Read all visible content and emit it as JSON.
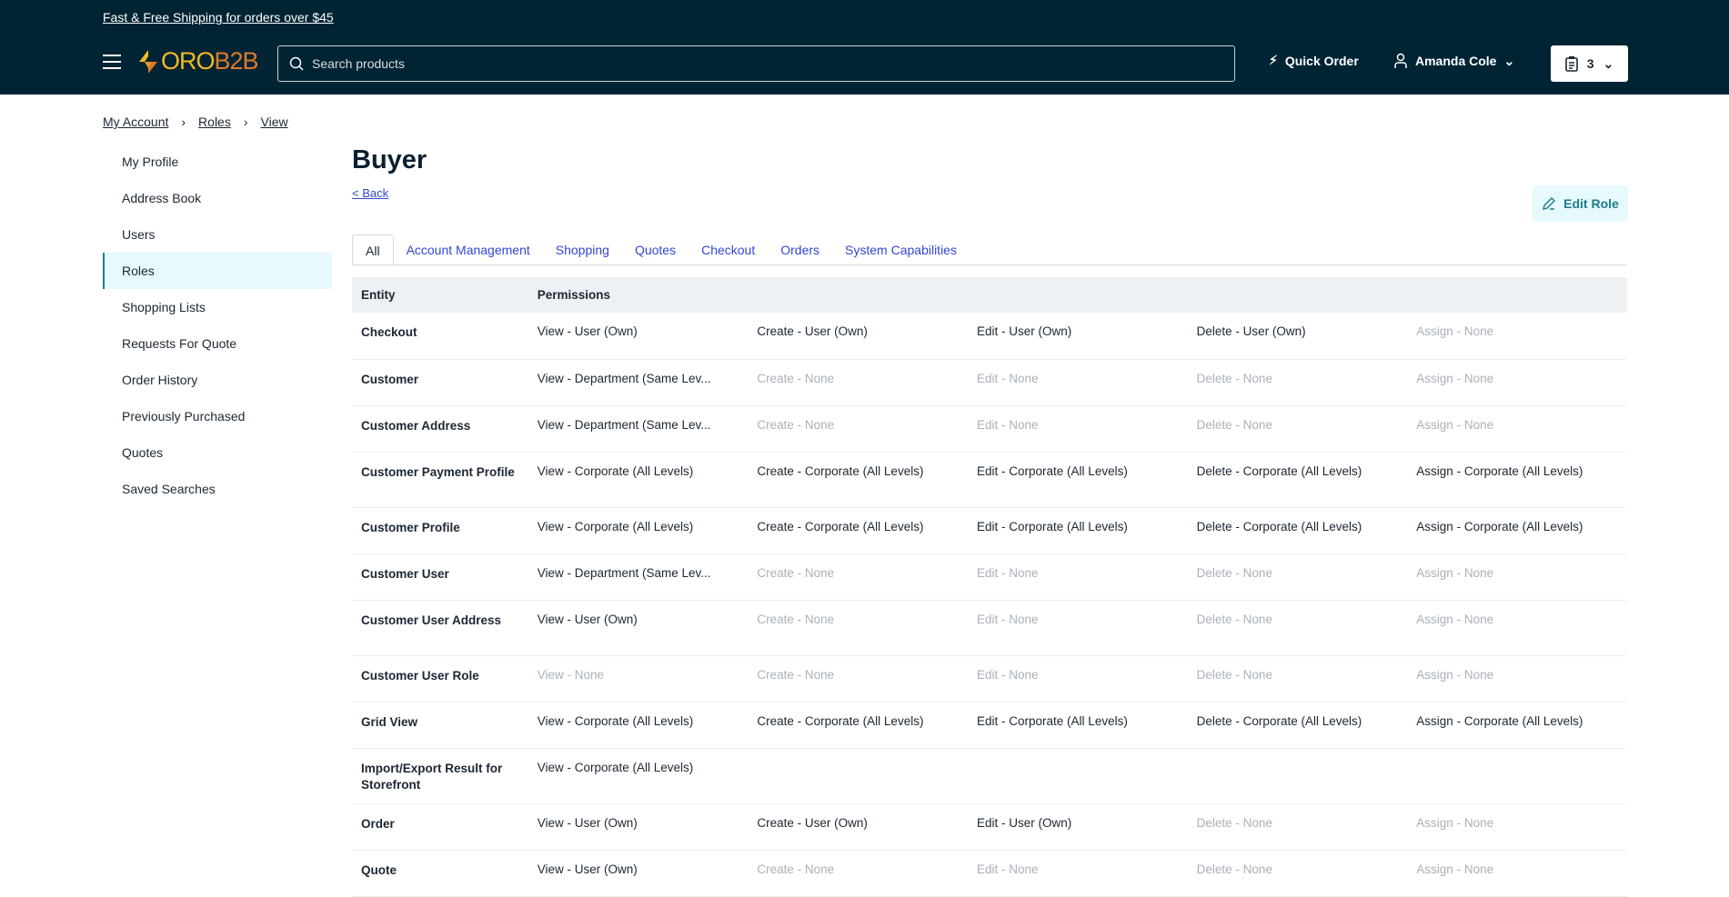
{
  "header": {
    "promo": "Fast & Free Shipping for orders over $45",
    "logo": "OROB2B",
    "search_placeholder": "Search products",
    "quick_order": "Quick Order",
    "user": "Amanda Cole",
    "cart_count": "3"
  },
  "breadcrumb": [
    "My Account",
    "Roles",
    "View"
  ],
  "sidebar": {
    "items": [
      "My Profile",
      "Address Book",
      "Users",
      "Roles",
      "Shopping Lists",
      "Requests For Quote",
      "Order History",
      "Previously Purchased",
      "Quotes",
      "Saved Searches"
    ],
    "active": "Roles"
  },
  "page": {
    "title": "Buyer",
    "back": "< Back",
    "edit": "Edit Role"
  },
  "tabs": [
    "All",
    "Account Management",
    "Shopping",
    "Quotes",
    "Checkout",
    "Orders",
    "System Capabilities"
  ],
  "table": {
    "headers": [
      "Entity",
      "Permissions"
    ],
    "rows": [
      {
        "entity": "Checkout",
        "perms": [
          "View - User (Own)",
          "Create - User (Own)",
          "Edit - User (Own)",
          "Delete - User (Own)",
          "Assign - None"
        ]
      },
      {
        "entity": "Customer",
        "perms": [
          "View - Department (Same Lev...",
          "Create - None",
          "Edit - None",
          "Delete - None",
          "Assign - None"
        ]
      },
      {
        "entity": "Customer Address",
        "perms": [
          "View - Department (Same Lev...",
          "Create - None",
          "Edit - None",
          "Delete - None",
          "Assign - None"
        ]
      },
      {
        "entity": "Customer Payment Profile",
        "perms": [
          "View - Corporate (All Levels)",
          "Create - Corporate (All Levels)",
          "Edit - Corporate (All Levels)",
          "Delete - Corporate (All Levels)",
          "Assign - Corporate (All Levels)"
        ]
      },
      {
        "entity": "Customer Profile",
        "perms": [
          "View - Corporate (All Levels)",
          "Create - Corporate (All Levels)",
          "Edit - Corporate (All Levels)",
          "Delete - Corporate (All Levels)",
          "Assign - Corporate (All Levels)"
        ]
      },
      {
        "entity": "Customer User",
        "perms": [
          "View - Department (Same Lev...",
          "Create - None",
          "Edit - None",
          "Delete - None",
          "Assign - None"
        ]
      },
      {
        "entity": "Customer User Address",
        "perms": [
          "View - User (Own)",
          "Create - None",
          "Edit - None",
          "Delete - None",
          "Assign - None"
        ]
      },
      {
        "entity": "Customer User Role",
        "perms": [
          "View - None",
          "Create - None",
          "Edit - None",
          "Delete - None",
          "Assign - None"
        ]
      },
      {
        "entity": "Grid View",
        "perms": [
          "View - Corporate (All Levels)",
          "Create - Corporate (All Levels)",
          "Edit - Corporate (All Levels)",
          "Delete - Corporate (All Levels)",
          "Assign - Corporate (All Levels)"
        ]
      },
      {
        "entity": "Import/Export Result for Storefront",
        "perms": [
          "View - Corporate (All Levels)",
          "",
          "",
          "",
          ""
        ]
      },
      {
        "entity": "Order",
        "perms": [
          "View - User (Own)",
          "Create - User (Own)",
          "Edit - User (Own)",
          "Delete - None",
          "Assign - None"
        ]
      },
      {
        "entity": "Quote",
        "perms": [
          "View - User (Own)",
          "Create - None",
          "Edit - None",
          "Delete - None",
          "Assign - None"
        ]
      }
    ]
  }
}
